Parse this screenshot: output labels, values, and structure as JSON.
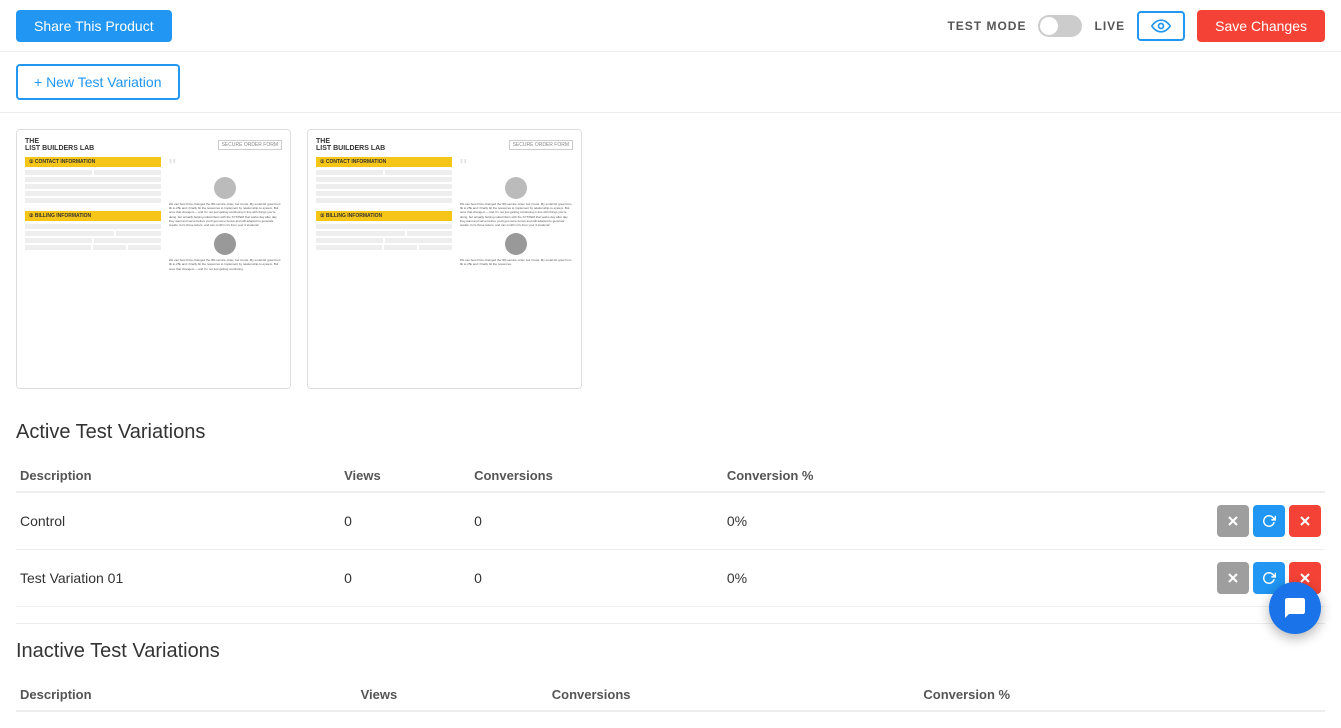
{
  "header": {
    "share_label": "Share This Product",
    "test_mode_label": "TEST MODE",
    "live_label": "LIVE",
    "save_label": "Save Changes"
  },
  "variation_bar": {
    "new_btn_label": "+ New Test Variation"
  },
  "previews": [
    {
      "id": "preview-1",
      "alt": "Control preview"
    },
    {
      "id": "preview-2",
      "alt": "Variation 01 preview"
    }
  ],
  "active_section": {
    "title": "Active Test Variations",
    "columns": [
      "Description",
      "Views",
      "Conversions",
      "Conversion %"
    ],
    "rows": [
      {
        "description": "Control",
        "views": "0",
        "conversions": "0",
        "conversion_pct": "0%"
      },
      {
        "description": "Test Variation 01",
        "views": "0",
        "conversions": "0",
        "conversion_pct": "0%"
      }
    ]
  },
  "inactive_section": {
    "title": "Inactive Test Variations",
    "columns": [
      "Description",
      "Views",
      "Conversions",
      "Conversion %"
    ]
  },
  "icons": {
    "eye": "👁",
    "x": "✕",
    "refresh": "↻",
    "trash": "✕",
    "chat": "💬"
  }
}
